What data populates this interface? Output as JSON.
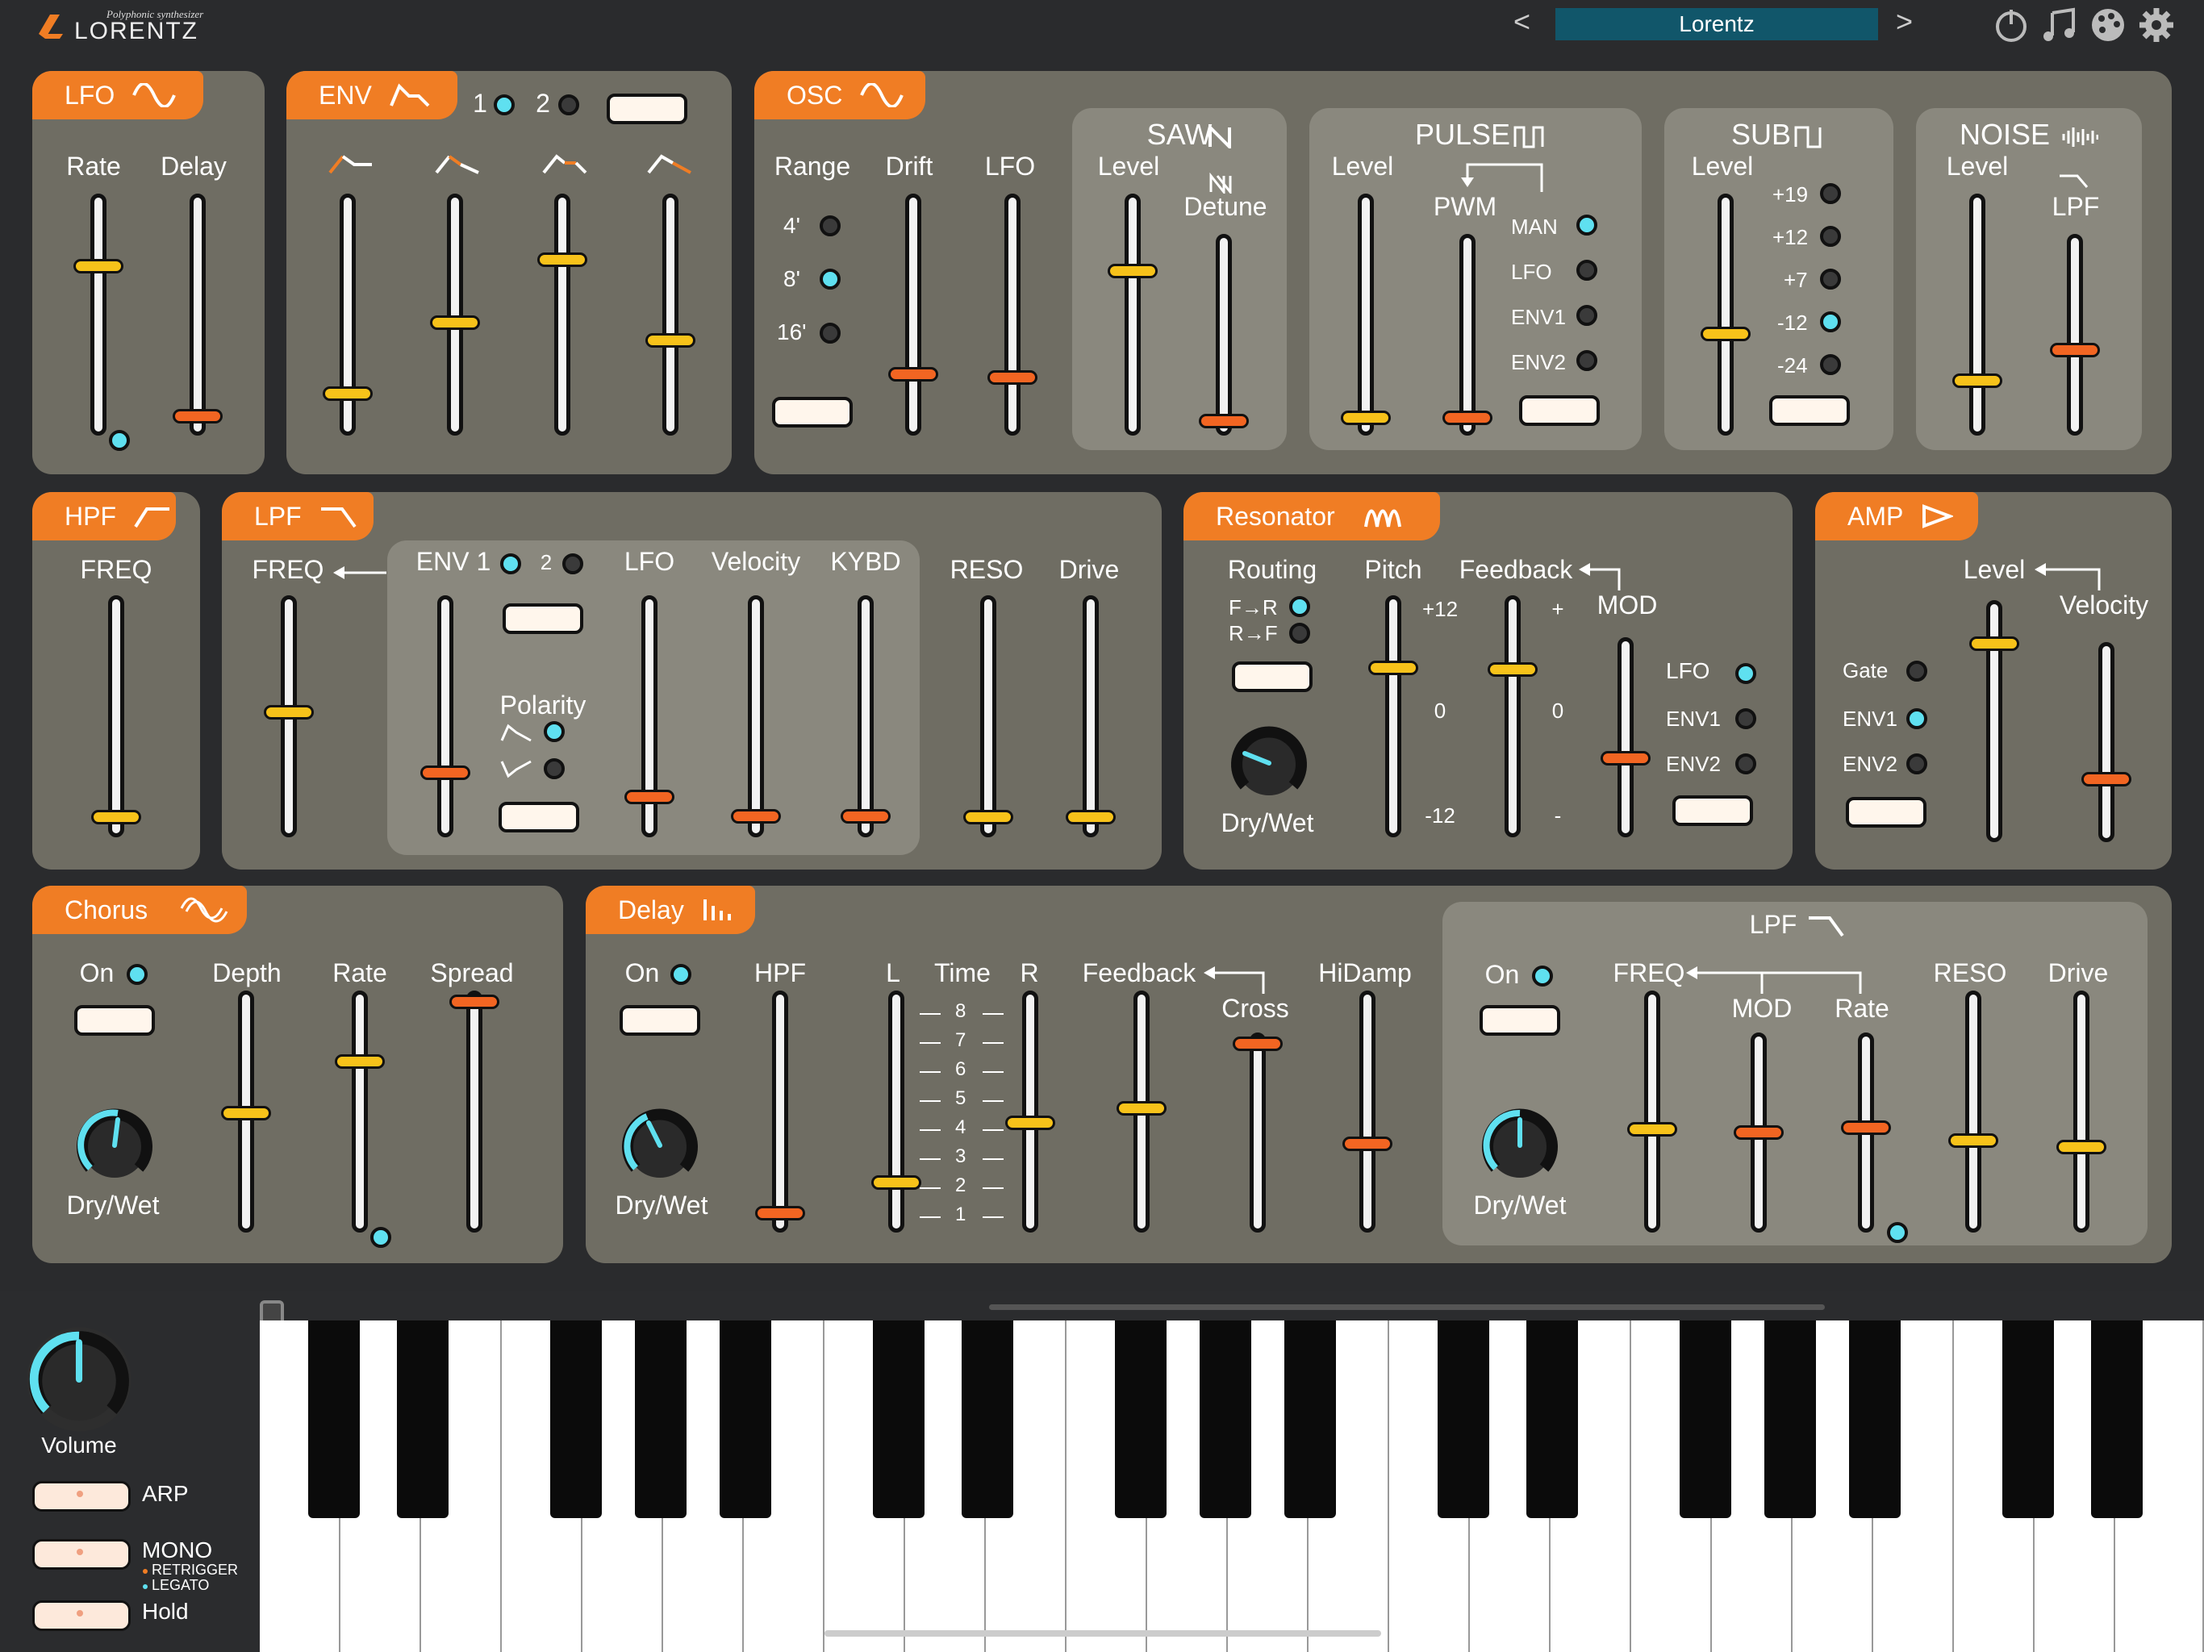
{
  "app": {
    "logo": "LORENTZ",
    "logo_tag": "Polyphonic synthesizer"
  },
  "topbar": {
    "preset_name": "Lorentz",
    "prev": "<",
    "next": ">",
    "icons": [
      "power-icon",
      "music-notes-icon",
      "palette-icon",
      "gear-icon"
    ]
  },
  "colors": {
    "accent": "#f07d24",
    "led_on": "#5fe0f0",
    "thumb_yellow": "#f7c21a",
    "thumb_orange": "#f26522",
    "panel": "#6f6d63",
    "subpanel": "#8a887e"
  },
  "lfo": {
    "title": "LFO",
    "rate": "Rate",
    "delay": "Delay",
    "rate_value": 0.72,
    "delay_value": 0.05
  },
  "env": {
    "title": "ENV",
    "sel1": "1",
    "sel2": "2",
    "values": [
      0.15,
      0.45,
      0.75,
      0.38
    ]
  },
  "osc": {
    "title": "OSC",
    "range": "Range",
    "drift": "Drift",
    "lfo": "LFO",
    "r4": "4'",
    "r8": "8'",
    "r16": "16'",
    "saw": {
      "title": "SAW",
      "level": "Level",
      "detune": "Detune"
    },
    "pulse": {
      "title": "PULSE",
      "level": "Level",
      "pwm": "PWM",
      "man": "MAN",
      "lfo": "LFO",
      "env1": "ENV1",
      "env2": "ENV2"
    },
    "sub": {
      "title": "SUB",
      "level": "Level",
      "p19": "+19",
      "p12": "+12",
      "p7": "+7",
      "m12": "-12",
      "m24": "-24"
    },
    "noise": {
      "title": "NOISE",
      "level": "Level",
      "lpf": "LPF"
    }
  },
  "hpf": {
    "title": "HPF",
    "freq": "FREQ"
  },
  "lpf": {
    "title": "LPF",
    "freq": "FREQ",
    "env1": "ENV 1",
    "env2": "2",
    "lfo": "LFO",
    "velocity": "Velocity",
    "kybd": "KYBD",
    "polarity": "Polarity",
    "reso": "RESO",
    "drive": "Drive"
  },
  "resonator": {
    "title": "Resonator",
    "routing": "Routing",
    "fr": "F→R",
    "rf": "R→F",
    "pitch": "Pitch",
    "feedback": "Feedback",
    "plus12": "+12",
    "zero": "0",
    "minus12": "-12",
    "plus": "+",
    "minus": "-",
    "mod": "MOD",
    "lfo": "LFO",
    "env1": "ENV1",
    "env2": "ENV2",
    "drywet": "Dry/Wet"
  },
  "amp": {
    "title": "AMP",
    "level": "Level",
    "velocity": "Velocity",
    "gate": "Gate",
    "env1": "ENV1",
    "env2": "ENV2"
  },
  "chorus": {
    "title": "Chorus",
    "on": "On",
    "depth": "Depth",
    "rate": "Rate",
    "spread": "Spread",
    "drywet": "Dry/Wet"
  },
  "delay": {
    "title": "Delay",
    "on": "On",
    "hpf": "HPF",
    "l": "L",
    "time": "Time",
    "r": "R",
    "feedback": "Feedback",
    "cross": "Cross",
    "hidamp": "HiDamp",
    "drywet": "Dry/Wet",
    "ticks": [
      "8",
      "7",
      "6",
      "5",
      "4",
      "3",
      "2",
      "1"
    ]
  },
  "delay_lpf": {
    "title": "LPF",
    "on": "On",
    "freq": "FREQ",
    "mod": "MOD",
    "rate": "Rate",
    "reso": "RESO",
    "drive": "Drive",
    "drywet": "Dry/Wet"
  },
  "keyboard": {
    "volume": "Volume",
    "arp": "ARP",
    "mono": "MONO",
    "retrigger": "RETRIGGER",
    "legato": "LEGATO",
    "hold": "Hold"
  }
}
